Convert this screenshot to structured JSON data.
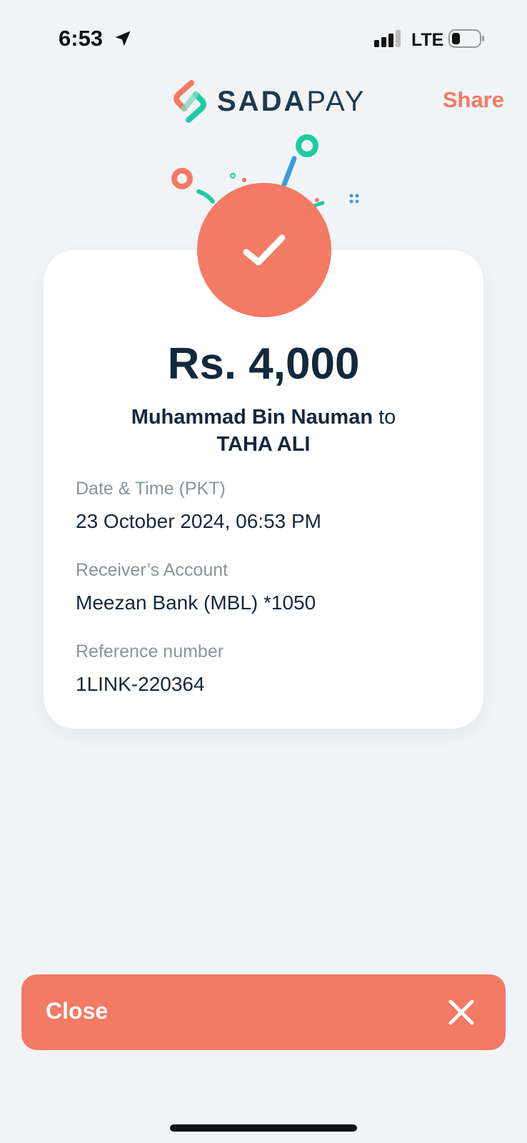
{
  "status_bar": {
    "time": "6:53",
    "network": "LTE",
    "icons": [
      "location-arrow-icon",
      "signal-icon",
      "battery-icon"
    ]
  },
  "header": {
    "logo_part1": "SADA",
    "logo_part2": "PAY",
    "share_label": "Share"
  },
  "receipt": {
    "amount": "Rs. 4,000",
    "sender": "Muhammad Bin Nauman",
    "connector": "to",
    "receiver": "TAHA ALI",
    "fields": [
      {
        "label": "Date & Time (PKT)",
        "value": "23 October 2024, 06:53 PM"
      },
      {
        "label": "Receiver’s Account",
        "value": "Meezan Bank (MBL) *1050"
      },
      {
        "label": "Reference number",
        "value": "1LINK-220364"
      }
    ]
  },
  "footer": {
    "close_label": "Close"
  },
  "colors": {
    "accent": "#f37a64",
    "teal": "#1fcba3",
    "blue": "#3a9be0",
    "text_dark": "#14283c",
    "text_muted": "#8a949c",
    "background": "#f1f4f6"
  }
}
